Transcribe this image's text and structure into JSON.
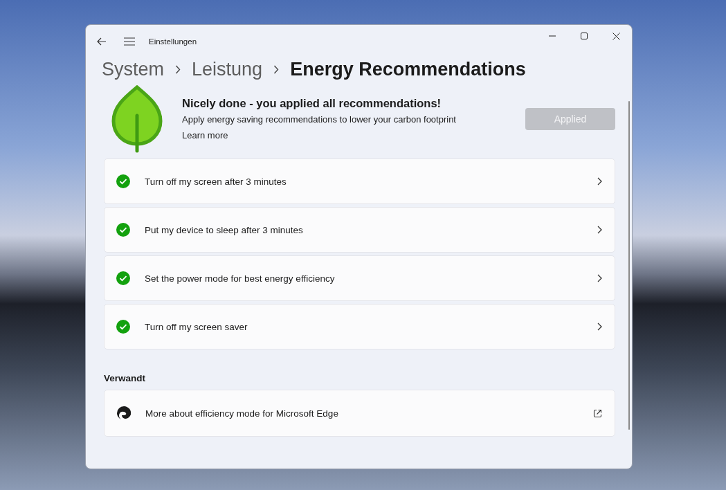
{
  "window": {
    "title": "Einstellungen"
  },
  "breadcrumb": [
    {
      "label": "System",
      "current": false
    },
    {
      "label": "Leistung",
      "current": false
    },
    {
      "label": "Energy Recommendations",
      "current": true
    }
  ],
  "banner": {
    "heading": "Nicely done - you applied all recommendations!",
    "description": "Apply energy saving recommendations to lower your carbon footprint",
    "link": "Learn more",
    "button": {
      "label": "Applied",
      "disabled": true
    }
  },
  "recommendations": [
    {
      "label": "Turn off my screen after 3 minutes",
      "applied": true
    },
    {
      "label": "Put my device to sleep after 3 minutes",
      "applied": true
    },
    {
      "label": "Set the power mode for best energy efficiency",
      "applied": true
    },
    {
      "label": "Turn off my screen saver",
      "applied": true
    }
  ],
  "related": {
    "heading": "Verwandt",
    "items": [
      {
        "label": "More about efficiency mode for Microsoft Edge"
      }
    ]
  }
}
